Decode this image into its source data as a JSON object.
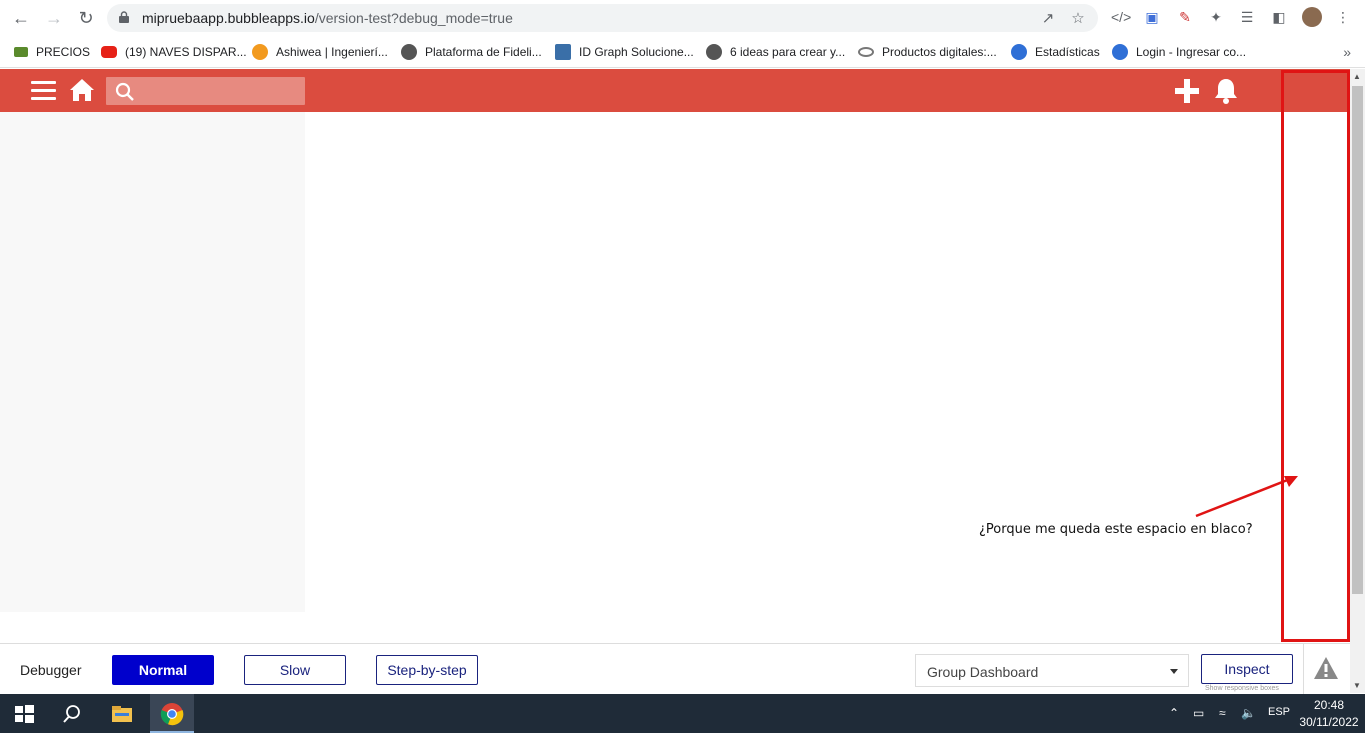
{
  "browser": {
    "url_host": "mipruebaapp.bubbleapps.io",
    "url_path": "/version-test?debug_mode=true"
  },
  "bookmarks": [
    {
      "label": "PRECIOS",
      "color": "#5a8a2c"
    },
    {
      "label": "(19) NAVES DISPAR...",
      "color": "#e62117"
    },
    {
      "label": "Ashiwea | Ingenierí...",
      "color": "#f29a1f"
    },
    {
      "label": "Plataforma de Fideli...",
      "color": "#555555"
    },
    {
      "label": "ID Graph Solucione...",
      "color": "#3a6fa8"
    },
    {
      "label": "6 ideas para crear y...",
      "color": "#555555"
    },
    {
      "label": "Productos digitales:...",
      "color": "#777777"
    },
    {
      "label": "Estadísticas",
      "color": "#2f6fd6"
    },
    {
      "label": "Login - Ingresar co...",
      "color": "#2f6fd6"
    }
  ],
  "header": {
    "search_placeholder": "",
    "color": "#db4c3f"
  },
  "annotation": {
    "text": "¿Porque me queda este espacio en blaco?"
  },
  "debugger": {
    "label": "Debugger",
    "modes": [
      "Normal",
      "Slow",
      "Step-by-step"
    ],
    "selected_group": "Group Dashboard",
    "inspect_label": "Inspect",
    "responsive_note": "Show responsive boxes"
  },
  "taskbar": {
    "language": "ESP",
    "time": "20:48",
    "date": "30/11/2022"
  }
}
